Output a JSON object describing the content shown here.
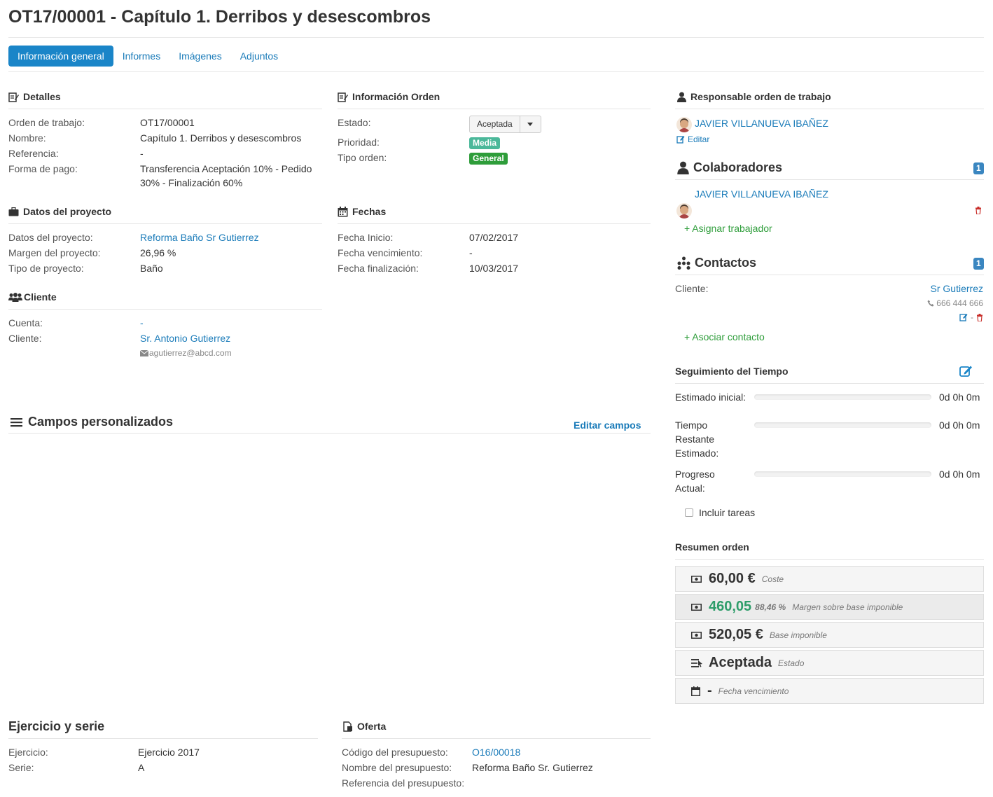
{
  "page": {
    "title": "OT17/00001 - Capítulo 1. Derribos y desescombros"
  },
  "tabs": [
    "Información general",
    "Informes",
    "Imágenes",
    "Adjuntos"
  ],
  "detalles": {
    "heading": "Detalles",
    "orden_label": "Orden de trabajo:",
    "orden_value": "OT17/00001",
    "nombre_label": "Nombre:",
    "nombre_value": "Capítulo 1. Derribos y desescombros",
    "referencia_label": "Referencia:",
    "referencia_value": "-",
    "pago_label": "Forma de pago:",
    "pago_value_line1": "Transferencia Aceptación 10% - Pedido",
    "pago_value_line2": "30% - Finalización 60%"
  },
  "info_orden": {
    "heading": "Información Orden",
    "estado_label": "Estado:",
    "estado_value": "Aceptada",
    "prioridad_label": "Prioridad:",
    "prioridad_value": "Media",
    "tipo_label": "Tipo orden:",
    "tipo_value": "General"
  },
  "responsable": {
    "heading": "Responsable orden de trabajo",
    "name": "JAVIER VILLANUEVA IBAÑEZ",
    "edit_label": "Editar"
  },
  "colaboradores": {
    "heading": "Colaboradores",
    "count": "1",
    "name": "JAVIER VILLANUEVA IBAÑEZ",
    "assign_label": "+ Asignar trabajador"
  },
  "contactos": {
    "heading": "Contactos",
    "count": "1",
    "cliente_label": "Cliente:",
    "cliente_value": "Sr Gutierrez",
    "phone": "666 444 666",
    "separator": "-",
    "associate_label": "+ Asociar contacto"
  },
  "datos_proyecto": {
    "heading": "Datos del proyecto",
    "proyecto_label": "Datos del proyecto:",
    "proyecto_value": "Reforma Baño Sr Gutierrez",
    "margen_label": "Margen del proyecto:",
    "margen_value": "26,96 %",
    "tipo_label": "Tipo de proyecto:",
    "tipo_value": "Baño"
  },
  "fechas": {
    "heading": "Fechas",
    "inicio_label": "Fecha Inicio:",
    "inicio_value": "07/02/2017",
    "vencimiento_label": "Fecha vencimiento:",
    "vencimiento_value": "-",
    "finalizacion_label": "Fecha finalización:",
    "finalizacion_value": "10/03/2017"
  },
  "cliente": {
    "heading": "Cliente",
    "cuenta_label": "Cuenta:",
    "cuenta_value": "-",
    "cliente_label": "Cliente:",
    "cliente_value": "Sr. Antonio Gutierrez",
    "email": "agutierrez@abcd.com"
  },
  "seguimiento": {
    "heading": "Seguimiento del Tiempo",
    "estimado_label": "Estimado inicial:",
    "estimado_value": "0d 0h 0m",
    "restante_label_1": "Tiempo",
    "restante_label_2": "Restante",
    "restante_label_3": "Estimado:",
    "restante_value": "0d 0h 0m",
    "progreso_label_1": "Progreso",
    "progreso_label_2": "Actual:",
    "progreso_value": "0d 0h 0m",
    "incluir_label": "Incluir tareas",
    "estimado_fill": 0,
    "restante_fill": 0,
    "progreso_fill": 0
  },
  "campos": {
    "heading": "Campos personalizados",
    "edit_label": "Editar campos"
  },
  "resumen": {
    "heading": "Resumen orden",
    "coste_value": "60,00 €",
    "coste_caption": "Coste",
    "margen_value": "460,05",
    "margen_pct": "88,46 %",
    "margen_caption": "Margen sobre base imponible",
    "base_value": "520,05 €",
    "base_caption": "Base imponible",
    "estado_value": "Aceptada",
    "estado_caption": "Estado",
    "fecha_value": "-",
    "fecha_caption": "Fecha vencimiento"
  },
  "ejercicio": {
    "heading": "Ejercicio y serie",
    "ejercicio_label": "Ejercicio:",
    "ejercicio_value": "Ejercicio 2017",
    "serie_label": "Serie:",
    "serie_value": "A"
  },
  "oferta": {
    "heading": "Oferta",
    "codigo_label": "Código del presupuesto:",
    "codigo_value": "O16/00018",
    "nombre_label": "Nombre del presupuesto:",
    "nombre_value": "Reforma Baño Sr. Gutierrez",
    "referencia_label": "Referencia del presupuesto:"
  },
  "colors": {
    "link": "#1a7bb9",
    "active_tab": "#1a85c8",
    "badge_media": "#4bb89a",
    "badge_general": "#2e9d3a",
    "badge_count": "#3a86c0",
    "add_link": "#2e9d3a",
    "margin_green": "#2e9d6a",
    "trash_red": "#c9302c"
  }
}
